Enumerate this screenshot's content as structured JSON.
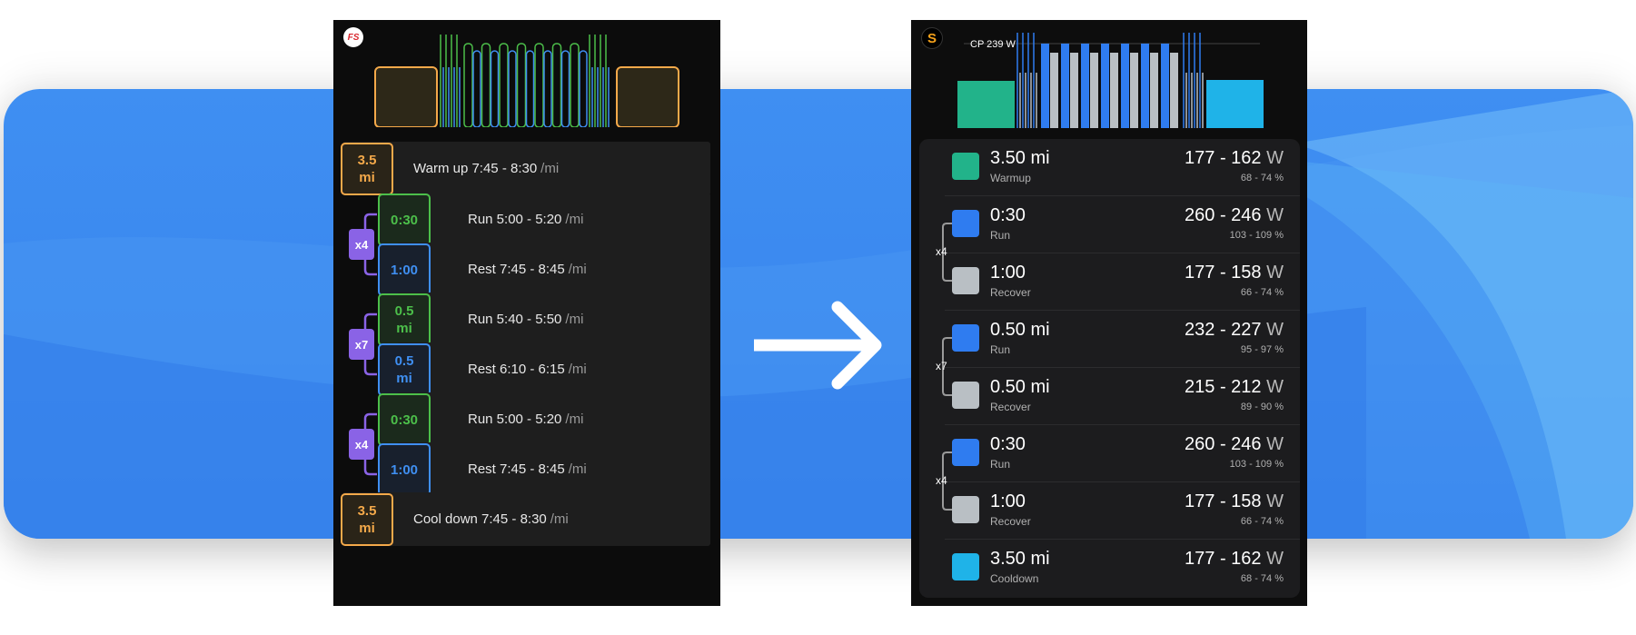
{
  "left": {
    "logo": "FS",
    "rows": [
      {
        "box": [
          "3.5",
          "mi"
        ],
        "text": "Warm up  7:45 - 8:30",
        "unit": "/mi",
        "color": "orange"
      },
      {
        "box": [
          "0:30"
        ],
        "text": "Run  5:00 - 5:20",
        "unit": "/mi",
        "color": "green"
      },
      {
        "box": [
          "1:00"
        ],
        "text": "Rest  7:45 - 8:45",
        "unit": "/mi",
        "color": "blue"
      },
      {
        "box": [
          "0.5",
          "mi"
        ],
        "text": "Run  5:40 - 5:50",
        "unit": "/mi",
        "color": "green"
      },
      {
        "box": [
          "0.5",
          "mi"
        ],
        "text": "Rest  6:10 - 6:15",
        "unit": "/mi",
        "color": "blue"
      },
      {
        "box": [
          "0:30"
        ],
        "text": "Run  5:00 - 5:20",
        "unit": "/mi",
        "color": "green"
      },
      {
        "box": [
          "1:00"
        ],
        "text": "Rest  7:45 - 8:45",
        "unit": "/mi",
        "color": "blue"
      },
      {
        "box": [
          "3.5",
          "mi"
        ],
        "text": "Cool down  7:45 - 8:30",
        "unit": "/mi",
        "color": "orange"
      }
    ],
    "repeats": [
      "x4",
      "x7",
      "x4"
    ]
  },
  "right": {
    "logo": "S",
    "cp_label": "CP 239 W",
    "rows": [
      {
        "main": "3.50 mi",
        "sub": "Warmup",
        "watts": "177 - 162",
        "unit": "W",
        "pct": "68 - 74 %",
        "color": "#22b38a"
      },
      {
        "main": "0:30",
        "sub": "Run",
        "watts": "260 - 246",
        "unit": "W",
        "pct": "103 - 109 %",
        "color": "#2f7cf0"
      },
      {
        "main": "1:00",
        "sub": "Recover",
        "watts": "177 - 158",
        "unit": "W",
        "pct": "66 - 74 %",
        "color": "#b9bfc4"
      },
      {
        "main": "0.50 mi",
        "sub": "Run",
        "watts": "232 - 227",
        "unit": "W",
        "pct": "95 - 97 %",
        "color": "#2f7cf0"
      },
      {
        "main": "0.50 mi",
        "sub": "Recover",
        "watts": "215 - 212",
        "unit": "W",
        "pct": "89 - 90 %",
        "color": "#b9bfc4"
      },
      {
        "main": "0:30",
        "sub": "Run",
        "watts": "260 - 246",
        "unit": "W",
        "pct": "103 - 109 %",
        "color": "#2f7cf0"
      },
      {
        "main": "1:00",
        "sub": "Recover",
        "watts": "177 - 158",
        "unit": "W",
        "pct": "66 - 74 %",
        "color": "#b9bfc4"
      },
      {
        "main": "3.50 mi",
        "sub": "Cooldown",
        "watts": "177 - 162",
        "unit": "W",
        "pct": "68 - 74 %",
        "color": "#1fb3e8"
      }
    ],
    "repeats": [
      "x4",
      "x7",
      "x4"
    ]
  }
}
